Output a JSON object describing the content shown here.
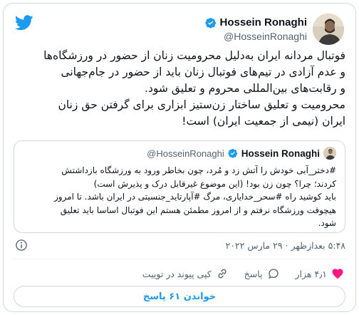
{
  "author": {
    "name": "Hossein Ronaghi",
    "handle": "@HosseinRonaghi"
  },
  "tweet": {
    "lines": [
      "فوتبال مردانه ایران به‌دلیل محرومیت زنان از حضور در ورزشگاه‌ها",
      "و عدم آزادی در تیم‌های فوتبال زنان باید از حضور در جام‌جهانی",
      "و رقابت‌های بین‌المللی محروم و تعلیق شود.",
      "محرومیت و تعلیق ساختار زن‌ستیز ابزاری برای گرفتن حق زنان",
      "ایران (نیمی از جمعیت ایران) است!"
    ]
  },
  "quote": {
    "name": "Hossein Ronaghi",
    "handle": "@HosseinRonaghi",
    "lines": [
      "#دختر_آبی خودش را آتش زد و مُرد، چون بخاطر ورود به ورزشگاه بازداشتش",
      "کردند؛ چرا؟ چون زن بود! (این موضوع غیرقابل درک و پذیرش است)",
      "باید کوشید راه #سحر_خدایاری، مرگ #آپارتاید_جنسیتی در ایران باشد. تا امروز",
      "هیچوقت ورزشگاه نرفتم و از امروز مطمئن هستم این فوتبال اساسا باید تعلیق",
      "شود."
    ]
  },
  "meta": {
    "timestamp": "۵:۴۸ بعدازظهر · ۲۹ مارس ۲۰۲۲"
  },
  "actions": {
    "likes": "۴٫۱ هزار",
    "reply": "پاسخ",
    "copy_link": "کپی پیوند در توییت"
  },
  "replies_button": "خواندن ۶۱ پاسخ",
  "colors": {
    "twitter_blue": "#1d9bf0",
    "like_red": "#f91880",
    "border": "#cfd9de",
    "muted_text": "#536471"
  }
}
